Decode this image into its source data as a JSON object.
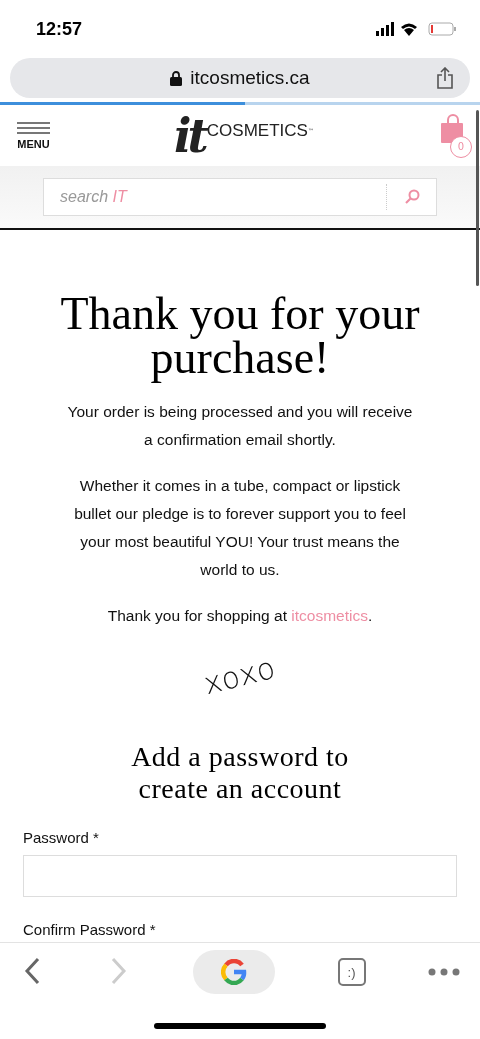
{
  "status_bar": {
    "time": "12:57"
  },
  "address_bar": {
    "url": "itcosmetics.ca",
    "load_progress": {
      "level": 0.51
    }
  },
  "header": {
    "menu_label": "MENU",
    "logo": {
      "script": "it",
      "word": "COSMETICS",
      "mark": "™"
    },
    "cart_count": "0"
  },
  "search": {
    "placeholder": "search",
    "placeholder_accent": "IT"
  },
  "confirmation": {
    "title": "Thank you for your purchase!",
    "paragraphs": [
      "Your order is being processed and you will receive a confirmation email shortly.",
      "Whether it comes in a tube, compact or lipstick bullet our pledge is to forever support you to feel your most beautiful YOU! Your trust means the world to us."
    ],
    "shopping_text": "Thank you for shopping at",
    "shopping_link": "itcosmetics",
    "shopping_end": ".",
    "signoff": "xoxo"
  },
  "account_form": {
    "title": "Add a password to create an account",
    "fields": [
      {
        "label": "Password *"
      },
      {
        "label": "Confirm Password *"
      }
    ]
  },
  "toolbar": {
    "tabs_label": ":)"
  }
}
